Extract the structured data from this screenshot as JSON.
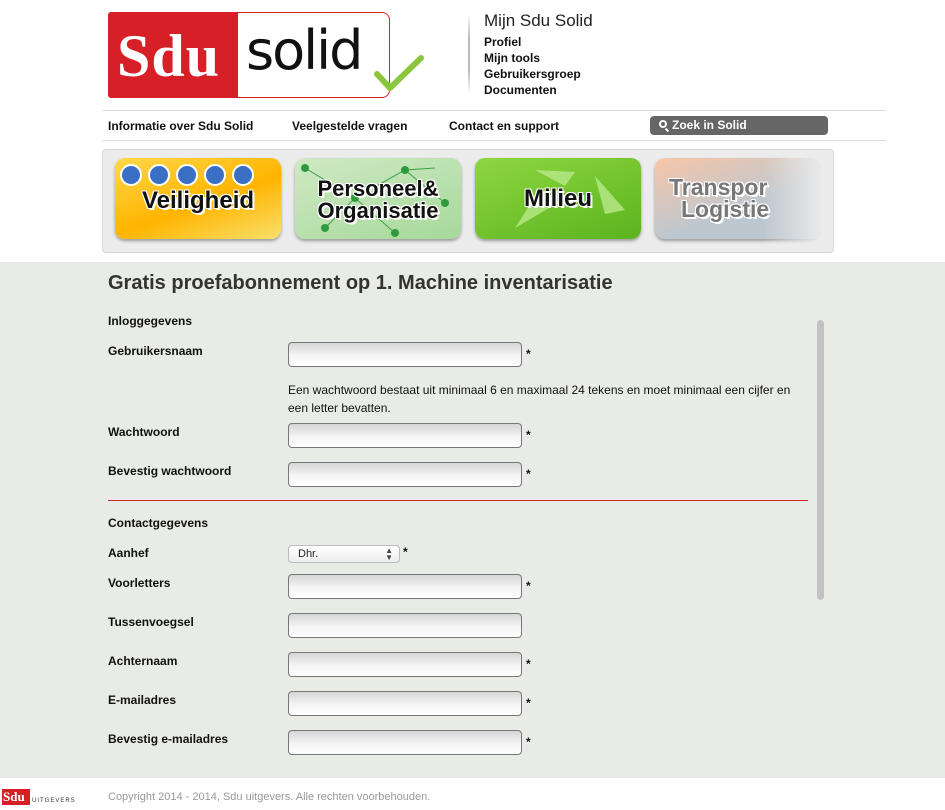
{
  "brand": {
    "sdu": "Sdu",
    "solid": "solid",
    "footer_sdu": "Sdu",
    "footer_uitgevers": "UITGEVERS"
  },
  "account": {
    "title": "Mijn Sdu Solid",
    "items": [
      "Profiel",
      "Mijn tools",
      "Gebruikersgroep",
      "Documenten"
    ]
  },
  "nav": {
    "links": [
      "Informatie over Sdu Solid",
      "Veelgestelde vragen",
      "Contact en support"
    ],
    "search_label": "Zoek in Solid"
  },
  "banners": [
    {
      "line1": "Veiligheid",
      "line2": ""
    },
    {
      "line1": "Personeel&",
      "line2": "Organisatie"
    },
    {
      "line1": "Milieu",
      "line2": ""
    },
    {
      "line1": "Transpor",
      "line2": "Logistie"
    }
  ],
  "page_title": "Gratis proefabonnement op 1. Machine inventarisatie",
  "form": {
    "login_section": "Inloggegevens",
    "username_label": "Gebruikersnaam",
    "password_hint": "Een wachtwoord bestaat uit minimaal 6 en maximaal 24 tekens en moet minimaal een cijfer en een letter bevatten.",
    "password_label": "Wachtwoord",
    "confirm_password_label": "Bevestig wachtwoord",
    "contact_section": "Contactgegevens",
    "salutation_label": "Aanhef",
    "salutation_value": "Dhr.",
    "initials_label": "Voorletters",
    "infix_label": "Tussenvoegsel",
    "lastname_label": "Achternaam",
    "email_label": "E-mailadres",
    "confirm_email_label": "Bevestig e-mailadres",
    "required_mark": "*"
  },
  "footer": {
    "copyright": "Copyright 2014 - 2014, Sdu uitgevers. Alle rechten voorbehouden."
  },
  "colors": {
    "brand_red": "#d61f26",
    "divider_red": "#c62828",
    "check_green": "#8cc63f"
  }
}
